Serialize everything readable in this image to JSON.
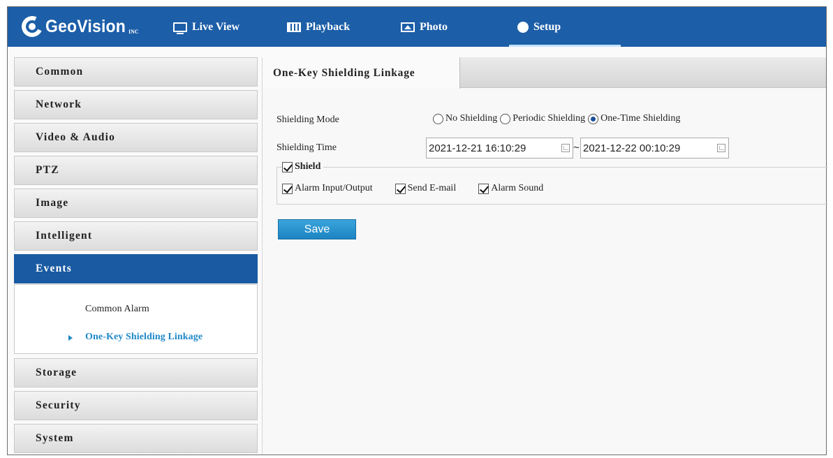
{
  "brand": {
    "name": "GeoVision",
    "tm": "INC"
  },
  "nav": {
    "live_view": "Live View",
    "playback": "Playback",
    "photo": "Photo",
    "setup": "Setup"
  },
  "sidebar": {
    "items": [
      {
        "label": "Common"
      },
      {
        "label": "Network"
      },
      {
        "label": "Video & Audio"
      },
      {
        "label": "PTZ"
      },
      {
        "label": "Image"
      },
      {
        "label": "Intelligent"
      },
      {
        "label": "Events"
      },
      {
        "label": "Storage"
      },
      {
        "label": "Security"
      },
      {
        "label": "System"
      }
    ],
    "events_sub": [
      {
        "label": "Common Alarm"
      },
      {
        "label": "One-Key Shielding Linkage"
      }
    ]
  },
  "content": {
    "tab": "One-Key Shielding Linkage",
    "shielding_mode_label": "Shielding Mode",
    "modes": [
      "No Shielding",
      "Periodic Shielding",
      "One-Time Shielding"
    ],
    "selected_mode": "One-Time Shielding",
    "shielding_time_label": "Shielding Time",
    "time_start": "2021-12-21 16:10:29",
    "time_separator": "~",
    "time_end": "2021-12-22 00:10:29",
    "shield_label": "Shield",
    "shield_checked": true,
    "options": [
      {
        "label": "Alarm Input/Output",
        "checked": true
      },
      {
        "label": "Send E-mail",
        "checked": true
      },
      {
        "label": "Alarm Sound",
        "checked": true
      }
    ],
    "save_label": "Save"
  },
  "colors": {
    "topbar": "#1c5ea8",
    "sidebar_active": "#1a5aa2",
    "link_selected": "#1e88c8",
    "save_button": "#2a94d0"
  }
}
